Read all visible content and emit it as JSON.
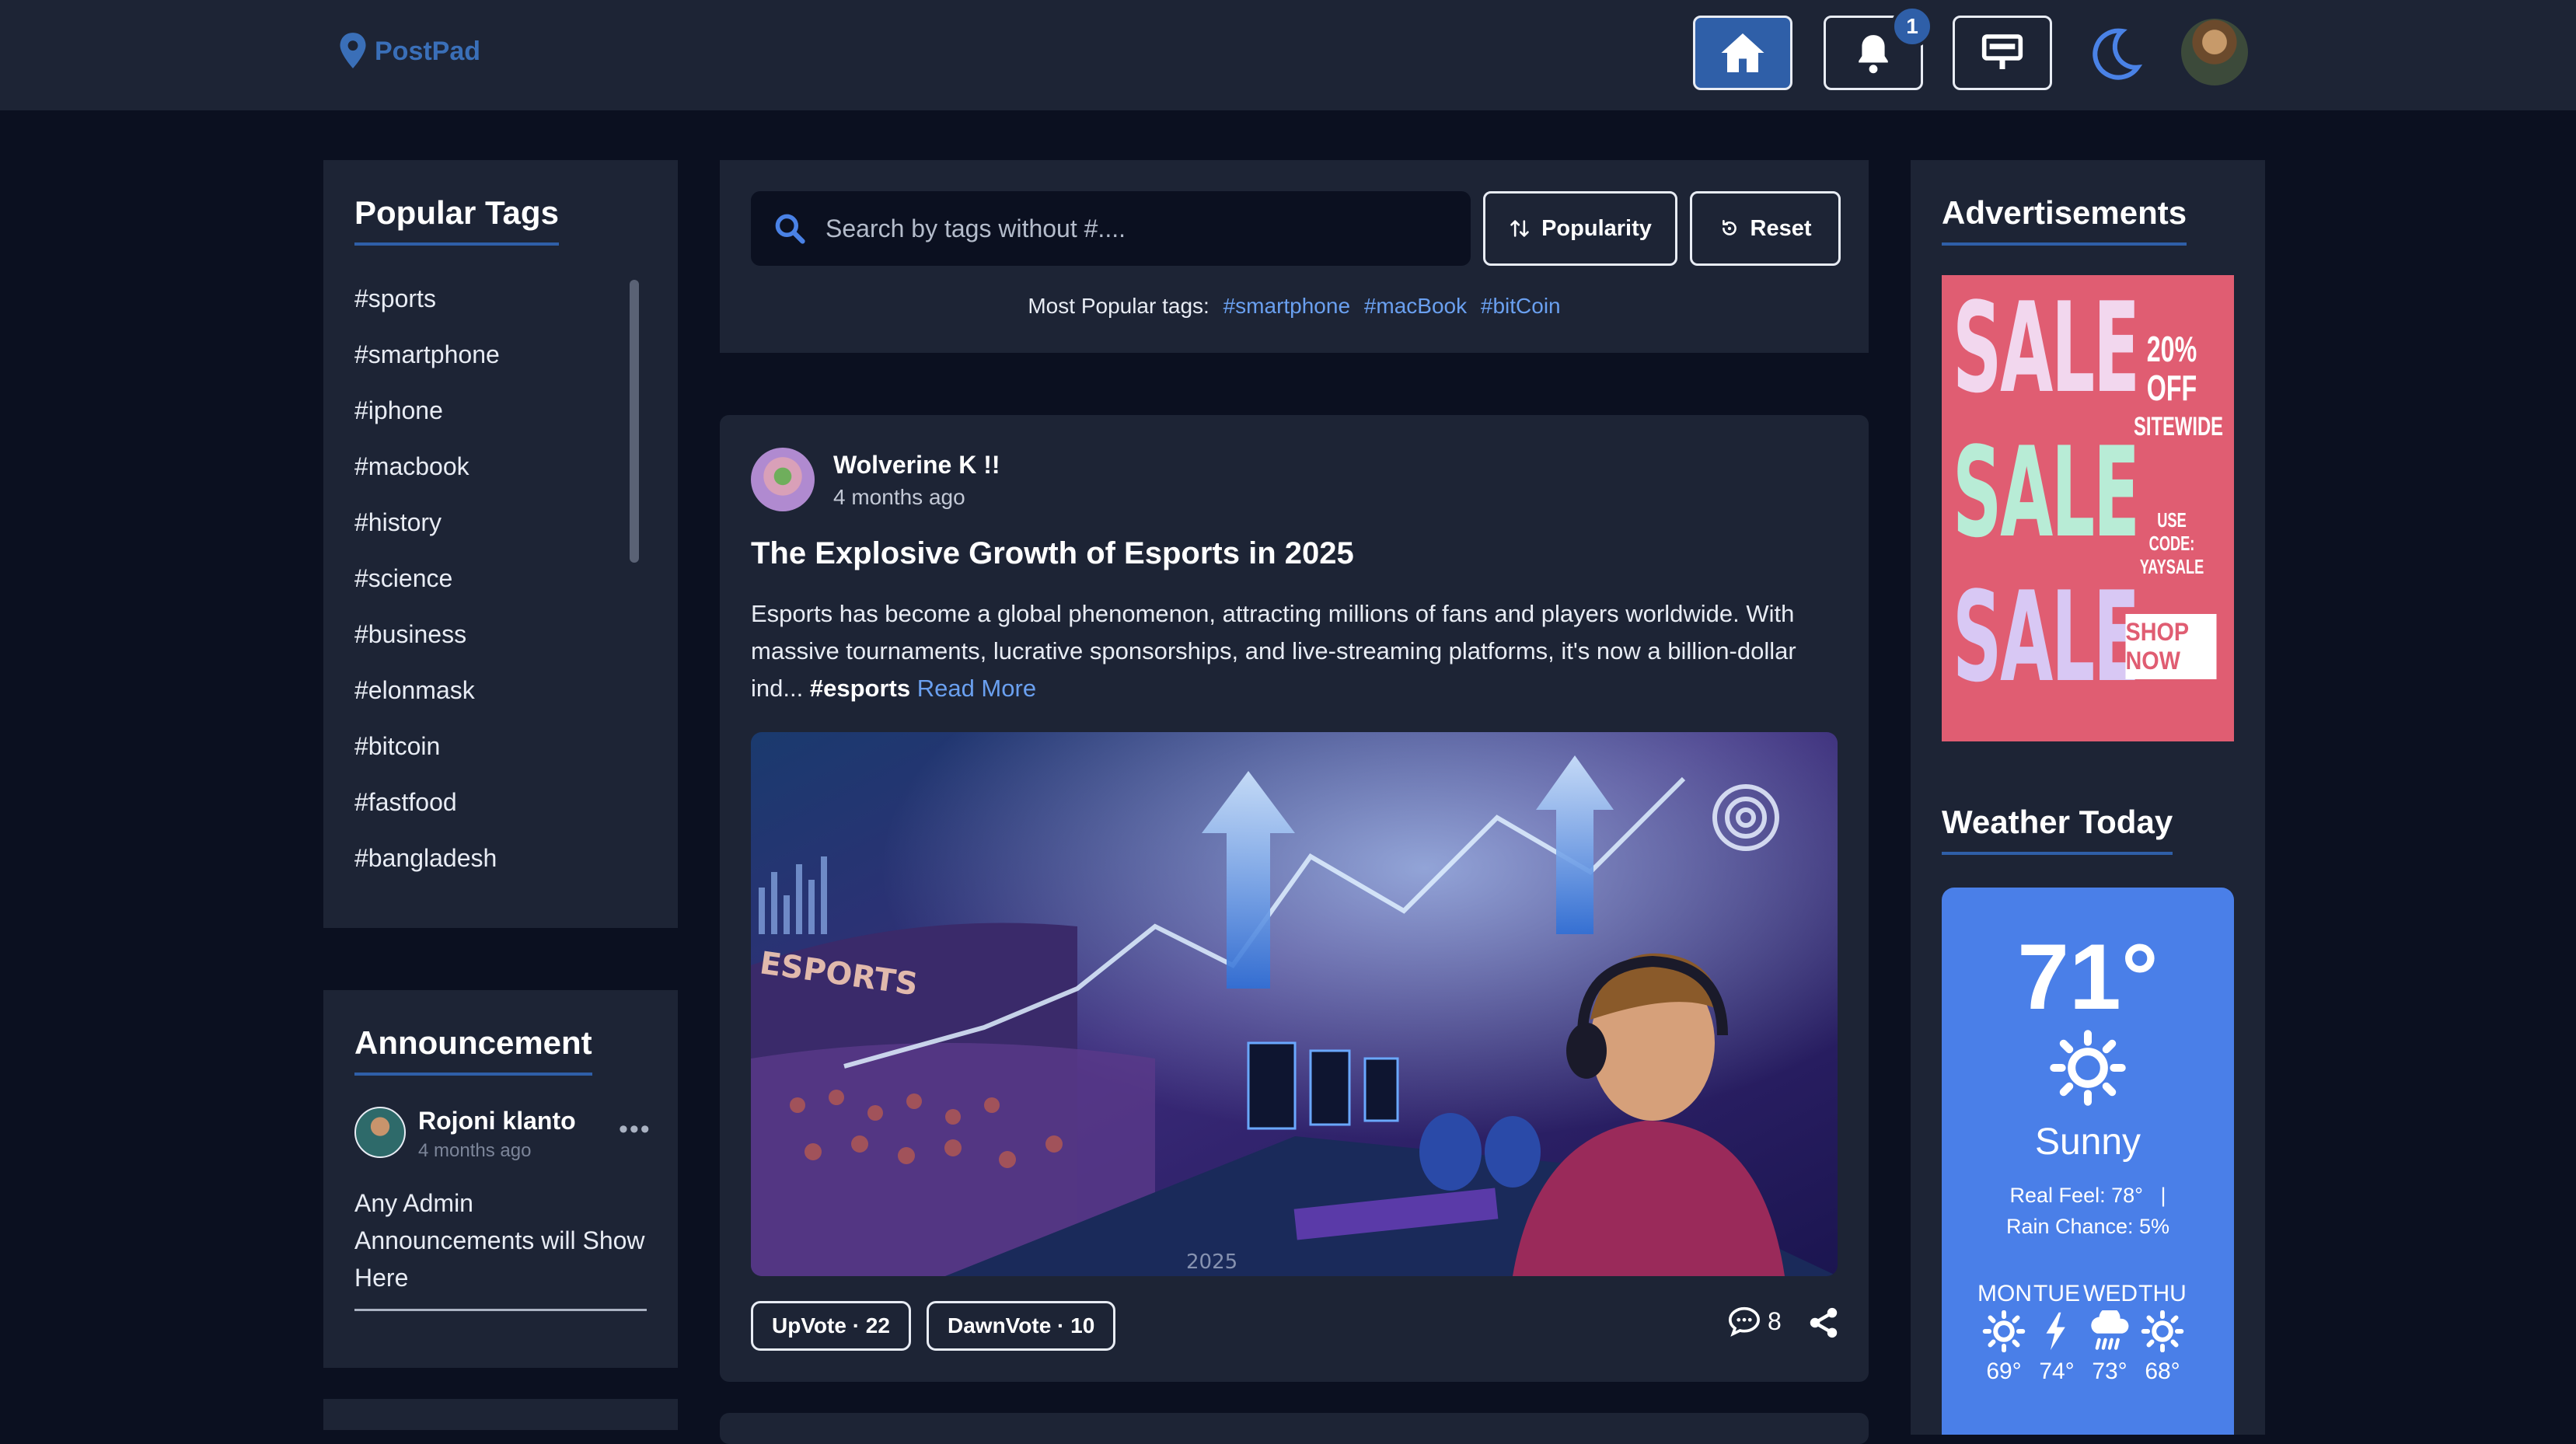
{
  "app": {
    "name": "PostPad"
  },
  "nav": {
    "notification_count": "1",
    "accent": "#2f5fa8"
  },
  "popular_tags": {
    "title": "Popular Tags",
    "items": [
      "#sports",
      "#smartphone",
      "#iphone",
      "#macbook",
      "#history",
      "#science",
      "#business",
      "#elonmask",
      "#bitcoin",
      "#fastfood",
      "#bangladesh"
    ]
  },
  "announcement": {
    "title": "Announcement",
    "author": "Rojoni klanto",
    "time": "4 months ago",
    "menu": "•••",
    "body": "Any Admin Announcements will Show Here"
  },
  "search": {
    "placeholder": "Search by tags without #....",
    "popularity_label": "Popularity",
    "reset_label": "Reset",
    "popular_prefix": "Most Popular tags:",
    "popular_tags": [
      "#smartphone",
      "#macBook",
      "#bitCoin"
    ]
  },
  "post": {
    "author": "Wolverine K !!",
    "time": "4 months ago",
    "title": "The Explosive Growth of Esports in 2025",
    "excerpt": "Esports has become a global phenomenon, attracting millions of fans and players worldwide. With massive tournaments, lucrative sponsorships, and live-streaming platforms, it's now a billion-dollar ind...",
    "hashtag": "#esports",
    "read_more": "Read More",
    "image_text_1": "ESPORTS",
    "image_text_2": "2025",
    "upvote_label": "UpVote · 22",
    "downvote_label": "DawnVote · 10",
    "comment_count": "8"
  },
  "ads": {
    "title": "Advertisements",
    "sale_word": "SALE",
    "discount": "20% OFF",
    "scope": "SITEWIDE",
    "code_label": "USE CODE:",
    "code": "YAYSALE",
    "cta": "SHOP NOW"
  },
  "weather": {
    "title": "Weather Today",
    "temperature": "71°",
    "condition": "Sunny",
    "real_feel": "Real Feel: 78°",
    "separator": "|",
    "rain_chance": "Rain Chance: 5%",
    "forecast": [
      {
        "day": "MON",
        "icon": "sun-icon",
        "temp": "69°"
      },
      {
        "day": "TUE",
        "icon": "lightning-icon",
        "temp": "74°"
      },
      {
        "day": "WED",
        "icon": "rain-cloud-icon",
        "temp": "73°"
      },
      {
        "day": "THU",
        "icon": "sun-icon",
        "temp": "68°"
      }
    ]
  }
}
